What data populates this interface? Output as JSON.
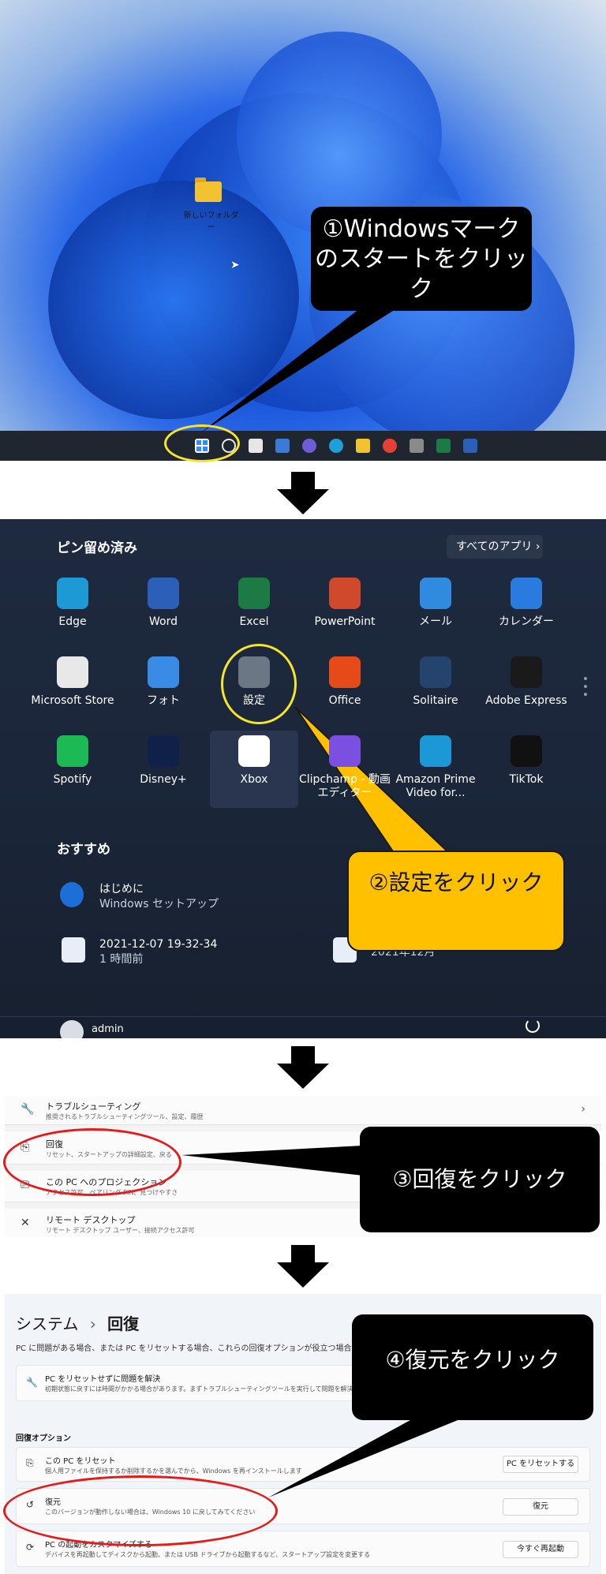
{
  "desktop": {
    "folder_label": "新しいフォルダー",
    "callout": "①Windowsマークのスタートをクリック"
  },
  "start_menu": {
    "pinned_title": "ピン留め済み",
    "all_apps": "すべてのアプリ  ›",
    "apps": [
      {
        "label": "Edge",
        "icon": "edge-icon",
        "color": "#1d9ad6"
      },
      {
        "label": "Word",
        "icon": "word-icon",
        "color": "#2b5fb8"
      },
      {
        "label": "Excel",
        "icon": "excel-icon",
        "color": "#1d7a45"
      },
      {
        "label": "PowerPoint",
        "icon": "powerpoint-icon",
        "color": "#d0492c"
      },
      {
        "label": "メール",
        "icon": "mail-icon",
        "color": "#2f8ae0"
      },
      {
        "label": "カレンダー",
        "icon": "calendar-icon",
        "color": "#2a7be0"
      },
      {
        "label": "Microsoft Store",
        "icon": "store-icon",
        "color": "#e8e8e8"
      },
      {
        "label": "フォト",
        "icon": "photos-icon",
        "color": "#3a8be6"
      },
      {
        "label": "設定",
        "icon": "settings-icon",
        "color": "#6b7785"
      },
      {
        "label": "Office",
        "icon": "office-icon",
        "color": "#e64a19"
      },
      {
        "label": "Solitaire",
        "icon": "solitaire-icon",
        "color": "#24446e"
      },
      {
        "label": "Adobe Express",
        "icon": "adobe-express-icon",
        "color": "#1a1a1a"
      },
      {
        "label": "Spotify",
        "icon": "spotify-icon",
        "color": "#1db954"
      },
      {
        "label": "Disney+",
        "icon": "disney-plus-icon",
        "color": "#0f2148"
      },
      {
        "label": "Xbox",
        "icon": "xbox-icon",
        "color": "#ffffff"
      },
      {
        "label": "Clipchamp - 動画エディター",
        "icon": "clipchamp-icon",
        "color": "#7b4fe0"
      },
      {
        "label": "Amazon Prime Video for...",
        "icon": "prime-video-icon",
        "color": "#1d98d6"
      },
      {
        "label": "TikTok",
        "icon": "tiktok-icon",
        "color": "#111111"
      }
    ],
    "recommended_title": "おすすめ",
    "recommended": [
      {
        "title": "はじめに",
        "sub": "Windows セットアップ"
      },
      {
        "title": "2021-12-07 19-32-34",
        "sub": "1 時間前"
      },
      {
        "title": "",
        "sub": "2021年12月"
      }
    ],
    "user": "admin",
    "callout": "②設定をクリック"
  },
  "settings_list": {
    "rows": [
      {
        "title": "トラブルシューティング",
        "sub": "推奨されるトラブルシューティングツール、設定、履歴"
      },
      {
        "title": "回復",
        "sub": "リセット、スタートアップの詳細設定、戻る"
      },
      {
        "title": "この PC へのプロジェクション",
        "sub": "アクセス許可、ペアリング PIN、見つけやすさ"
      },
      {
        "title": "リモート デスクトップ",
        "sub": "リモート デスクトップ ユーザー、接続アクセス許可"
      }
    ],
    "callout": "③回復をクリック"
  },
  "recovery": {
    "breadcrumb_parent": "システム",
    "breadcrumb_sep": "›",
    "breadcrumb_current": "回復",
    "description": "PC に問題がある場合、または PC をリセットする場合、これらの回復オプションが役立つ場合があります",
    "fix_card": {
      "title": "PC をリセットせずに問題を解決",
      "sub": "初期状態に戻すには時間がかかる場合があります。まずトラブルシューティングツールを実行して問題を解決してみてください"
    },
    "options_title": "回復オプション",
    "options": [
      {
        "title": "この PC をリセット",
        "sub": "個人用ファイルを保持するか削除するかを選んでから、Windows を再インストールします",
        "button": "PC をリセットする"
      },
      {
        "title": "復元",
        "sub": "このバージョンが動作しない場合は、Windows 10 に戻してみてください",
        "button": "復元"
      },
      {
        "title": "PC の起動をカスタマイズする",
        "sub": "デバイスを再起動してディスクから起動、または USB ドライブから起動するなど、スタートアップ設定を変更する",
        "button": "今すぐ再起動"
      }
    ],
    "callout": "④復元をクリック"
  }
}
